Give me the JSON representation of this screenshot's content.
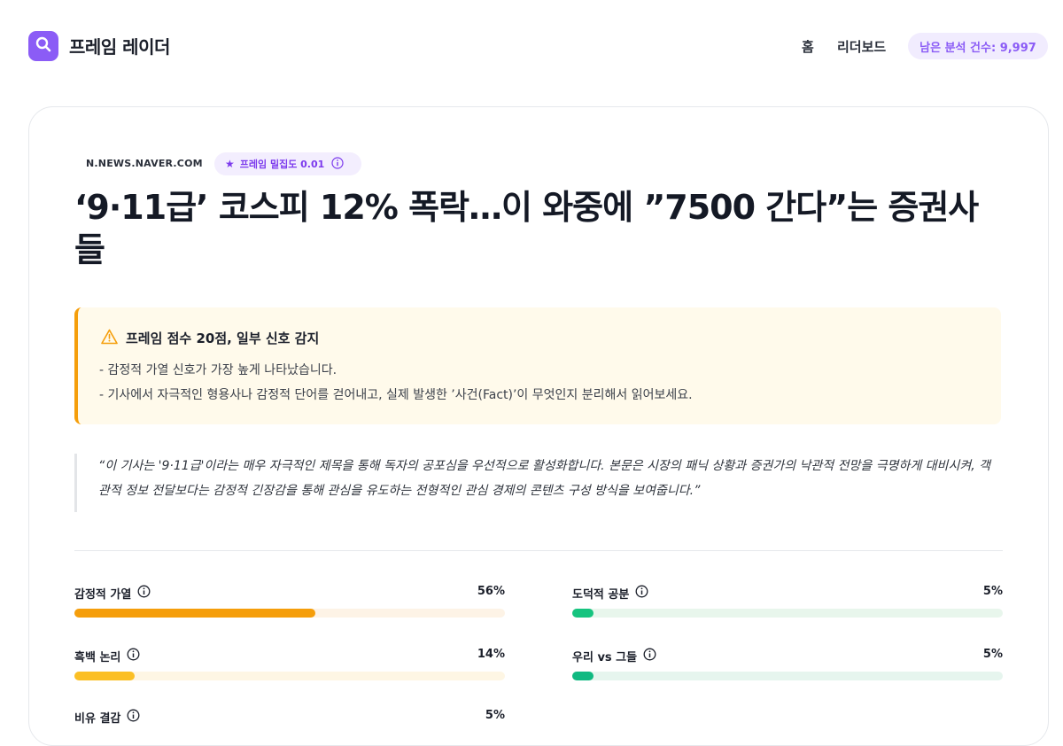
{
  "header": {
    "brand": "프레임 레이더",
    "nav": {
      "home": "홈",
      "leaderboard": "리더보드"
    },
    "quota": "남은 분석 건수: 9,997"
  },
  "article": {
    "source": "N.NEWS.NAVER.COM",
    "density_label": "프레임 밀집도 0.01",
    "title": "‘9·11급’ 코스피 12% 폭락…이 와중에 ”7500 간다”는 증권사들"
  },
  "alert": {
    "title": "프레임 점수 20점, 일부 신호 감지",
    "line1": "- 감정적 가열 신호가 가장 높게 나타났습니다.",
    "line2": "- 기사에서 자극적인 형용사나 감정적 단어를 걷어내고, 실제 발생한 ’사건(Fact)’이 무엇인지 분리해서 읽어보세요."
  },
  "quote": "“이 기사는 '9·11급'이라는 매우 자극적인 제목을 통해 독자의 공포심을 우선적으로 활성화합니다. 본문은 시장의 패닉 상황과 증권가의 낙관적 전망을 극명하게 대비시켜, 객관적 정보 전달보다는 감정적 긴장감을 통해 관심을 유도하는 전형적인 관심 경제의 콘텐츠 구성 방식을 보여줍니다.”",
  "metrics": [
    {
      "label": "감정적 가열",
      "pct": "56%",
      "value": 0.56,
      "color": "#f59e0b",
      "track": "#fdf3e6"
    },
    {
      "label": "도덕적 공분",
      "pct": "5%",
      "value": 0.05,
      "color": "#16c47f",
      "track": "#e8f6ec"
    },
    {
      "label": "흑백 논리",
      "pct": "14%",
      "value": 0.14,
      "color": "#fbbf24",
      "track": "#fef6e4"
    },
    {
      "label": "우리 vs 그들",
      "pct": "5%",
      "value": 0.05,
      "color": "#10b981",
      "track": "#e6f5ee"
    },
    {
      "label": "비유 결감",
      "pct": "5%",
      "value": 0.05,
      "color": "#f59e0b",
      "track": "#fdf3e6"
    }
  ],
  "colors": {
    "accent": "#8b5cf6",
    "warning": "#f59e0b"
  }
}
